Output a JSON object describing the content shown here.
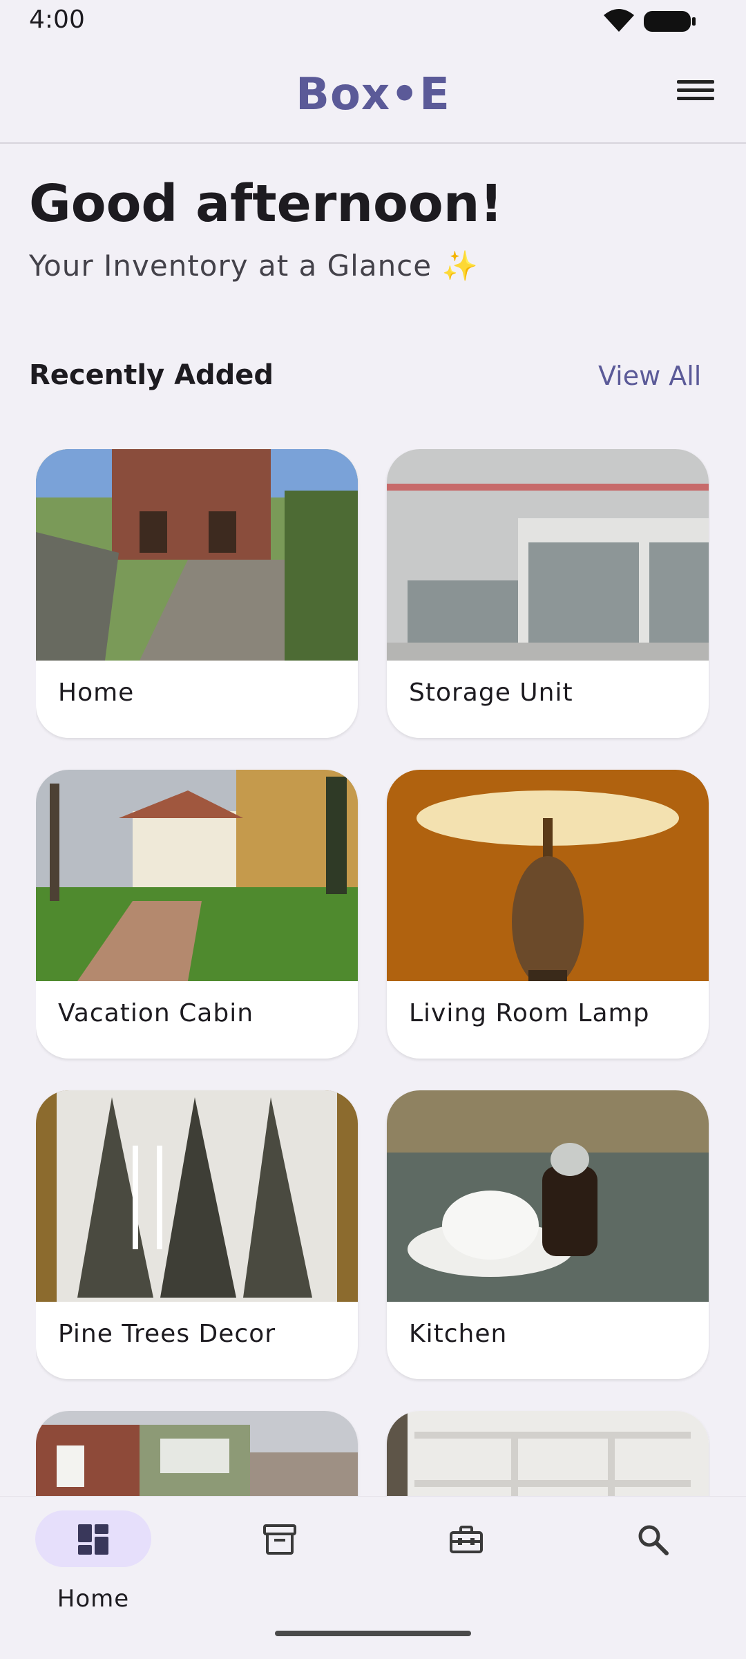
{
  "status": {
    "time": "4:00"
  },
  "app": {
    "title": "Box•E"
  },
  "greeting": {
    "title": "Good afternoon!",
    "subtitle": "Your Inventory at a Glance ✨"
  },
  "section": {
    "title": "Recently Added",
    "view_all": "View All"
  },
  "items": [
    {
      "label": "Home",
      "image": "brick house with garden stairs"
    },
    {
      "label": "Storage Unit",
      "image": "warehouse with roll-up doors"
    },
    {
      "label": "Vacation Cabin",
      "image": "villa with pathway and lawn"
    },
    {
      "label": "Living Room Lamp",
      "image": "illuminated lamp with shade"
    },
    {
      "label": "Pine Trees Decor",
      "image": "framed pine trees sketch"
    },
    {
      "label": "Kitchen",
      "image": "tea cup and syrup jar on glass table"
    },
    {
      "label": "",
      "image": "houses on a hillside"
    },
    {
      "label": "",
      "image": "white bookshelf"
    }
  ],
  "nav": [
    {
      "label": "Home",
      "icon": "dashboard-icon",
      "active": true
    },
    {
      "label": "",
      "icon": "archive-box-icon",
      "active": false
    },
    {
      "label": "",
      "icon": "toolbox-icon",
      "active": false
    },
    {
      "label": "",
      "icon": "search-icon",
      "active": false
    }
  ],
  "colors": {
    "accent": "#5b5a98",
    "background": "#f2f0f6",
    "active_pill": "#e6dffb"
  }
}
